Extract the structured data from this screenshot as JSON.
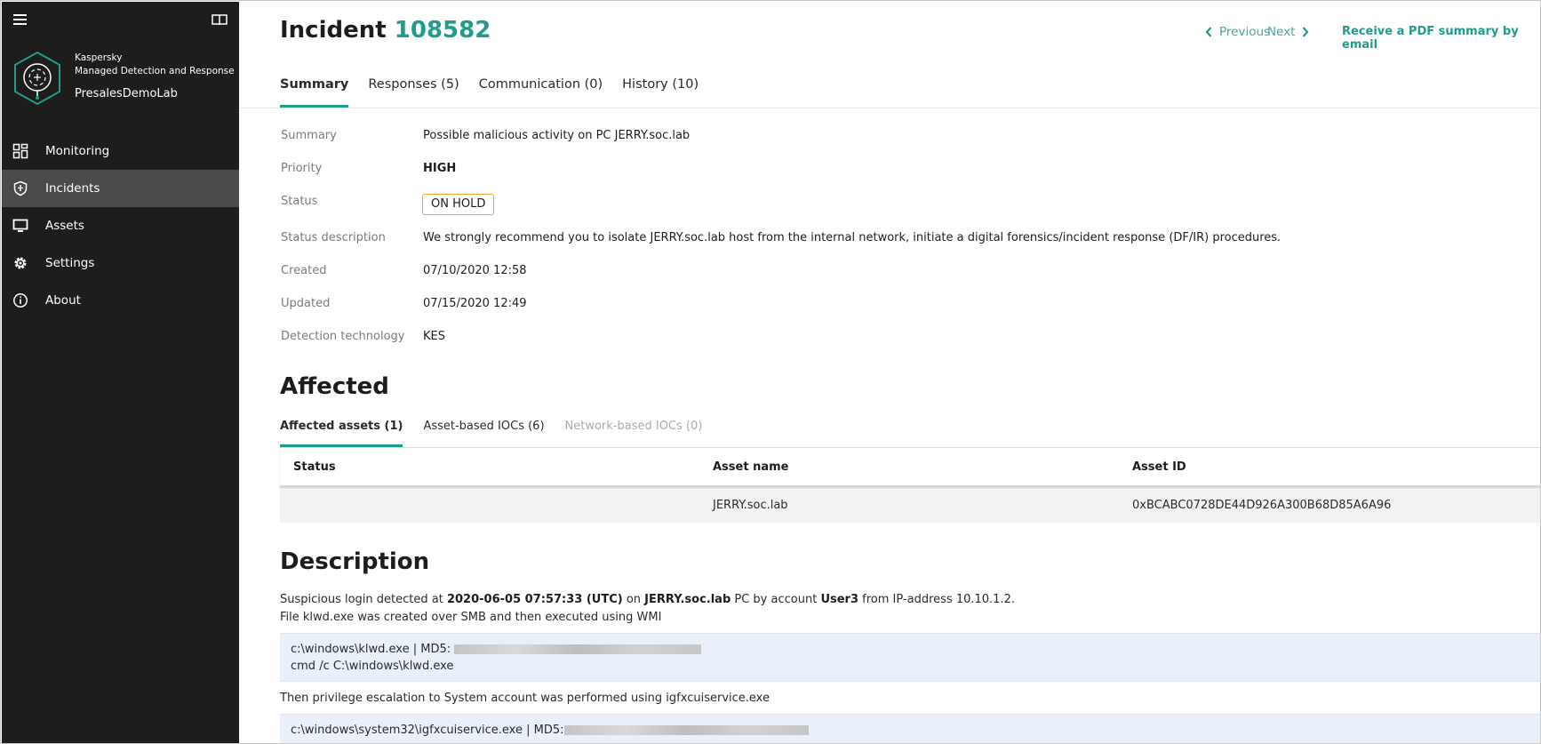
{
  "sidebar": {
    "brand_line1": "Kaspersky",
    "brand_line2": "Managed Detection and Response",
    "org_name": "PresalesDemoLab",
    "items": [
      {
        "label": "Monitoring",
        "icon": "dashboard-icon"
      },
      {
        "label": "Incidents",
        "icon": "shield-icon",
        "active": true
      },
      {
        "label": "Assets",
        "icon": "monitor-icon"
      },
      {
        "label": "Settings",
        "icon": "gear-icon"
      },
      {
        "label": "About",
        "icon": "info-icon"
      }
    ]
  },
  "header": {
    "title_word": "Incident",
    "incident_number": "108582",
    "previous_label": "Previous",
    "next_label": "Next",
    "pdf_link": "Receive a PDF summary by email"
  },
  "tabs": [
    {
      "label": "Summary",
      "active": true
    },
    {
      "label": "Responses (5)"
    },
    {
      "label": "Communication (0)"
    },
    {
      "label": "History (10)"
    }
  ],
  "summary": {
    "summary_label": "Summary",
    "summary_value": "Possible malicious activity on PC JERRY.soc.lab",
    "priority_label": "Priority",
    "priority_value": "HIGH",
    "status_label": "Status",
    "status_value": "ON HOLD",
    "status_desc_label": "Status description",
    "status_desc_value": "We strongly recommend you to isolate JERRY.soc.lab host from the internal network, initiate a digital forensics/incident response (DF/IR) procedures.",
    "created_label": "Created",
    "created_value": "07/10/2020 12:58",
    "updated_label": "Updated",
    "updated_value": "07/15/2020 12:49",
    "detection_label": "Detection technology",
    "detection_value": "KES"
  },
  "affected": {
    "title": "Affected",
    "subtabs": [
      {
        "label": "Affected assets (1)",
        "active": true
      },
      {
        "label": "Asset-based IOCs (6)"
      },
      {
        "label": "Network-based IOCs (0)",
        "disabled": true
      }
    ],
    "columns": [
      "Status",
      "Asset name",
      "Asset ID"
    ],
    "rows": [
      {
        "status": "",
        "asset_name": "JERRY.soc.lab",
        "asset_id": "0xBCABC0728DE44D926A300B68D85A6A96"
      }
    ]
  },
  "description": {
    "title": "Description",
    "l1_a": "Suspicious login detected at ",
    "l1_time": "2020-06-05 07:57:33 (UTC)",
    "l1_b": " on ",
    "l1_host": "JERRY.soc.lab",
    "l1_c": " PC by account ",
    "l1_account": "User3",
    "l1_d": " from IP-address 10.10.1.2.",
    "line2": "File klwd.exe was created over SMB and then executed using WMI",
    "code1_line1": "c:\\windows\\klwd.exe | MD5: ",
    "code1_line2": "cmd /c C:\\windows\\klwd.exe",
    "line3": "Then privilege escalation to System account was performed using igfxcuiservice.exe",
    "code2_line1": "c:\\windows\\system32\\igfxcuiservice.exe | MD5:"
  },
  "colors": {
    "accent": "#1f9c8b",
    "sidebar_bg": "#1d1d1b",
    "sidebar_active": "#4a4a4a",
    "status_border": "#f0a234",
    "code_bg": "#e9f0f9"
  }
}
